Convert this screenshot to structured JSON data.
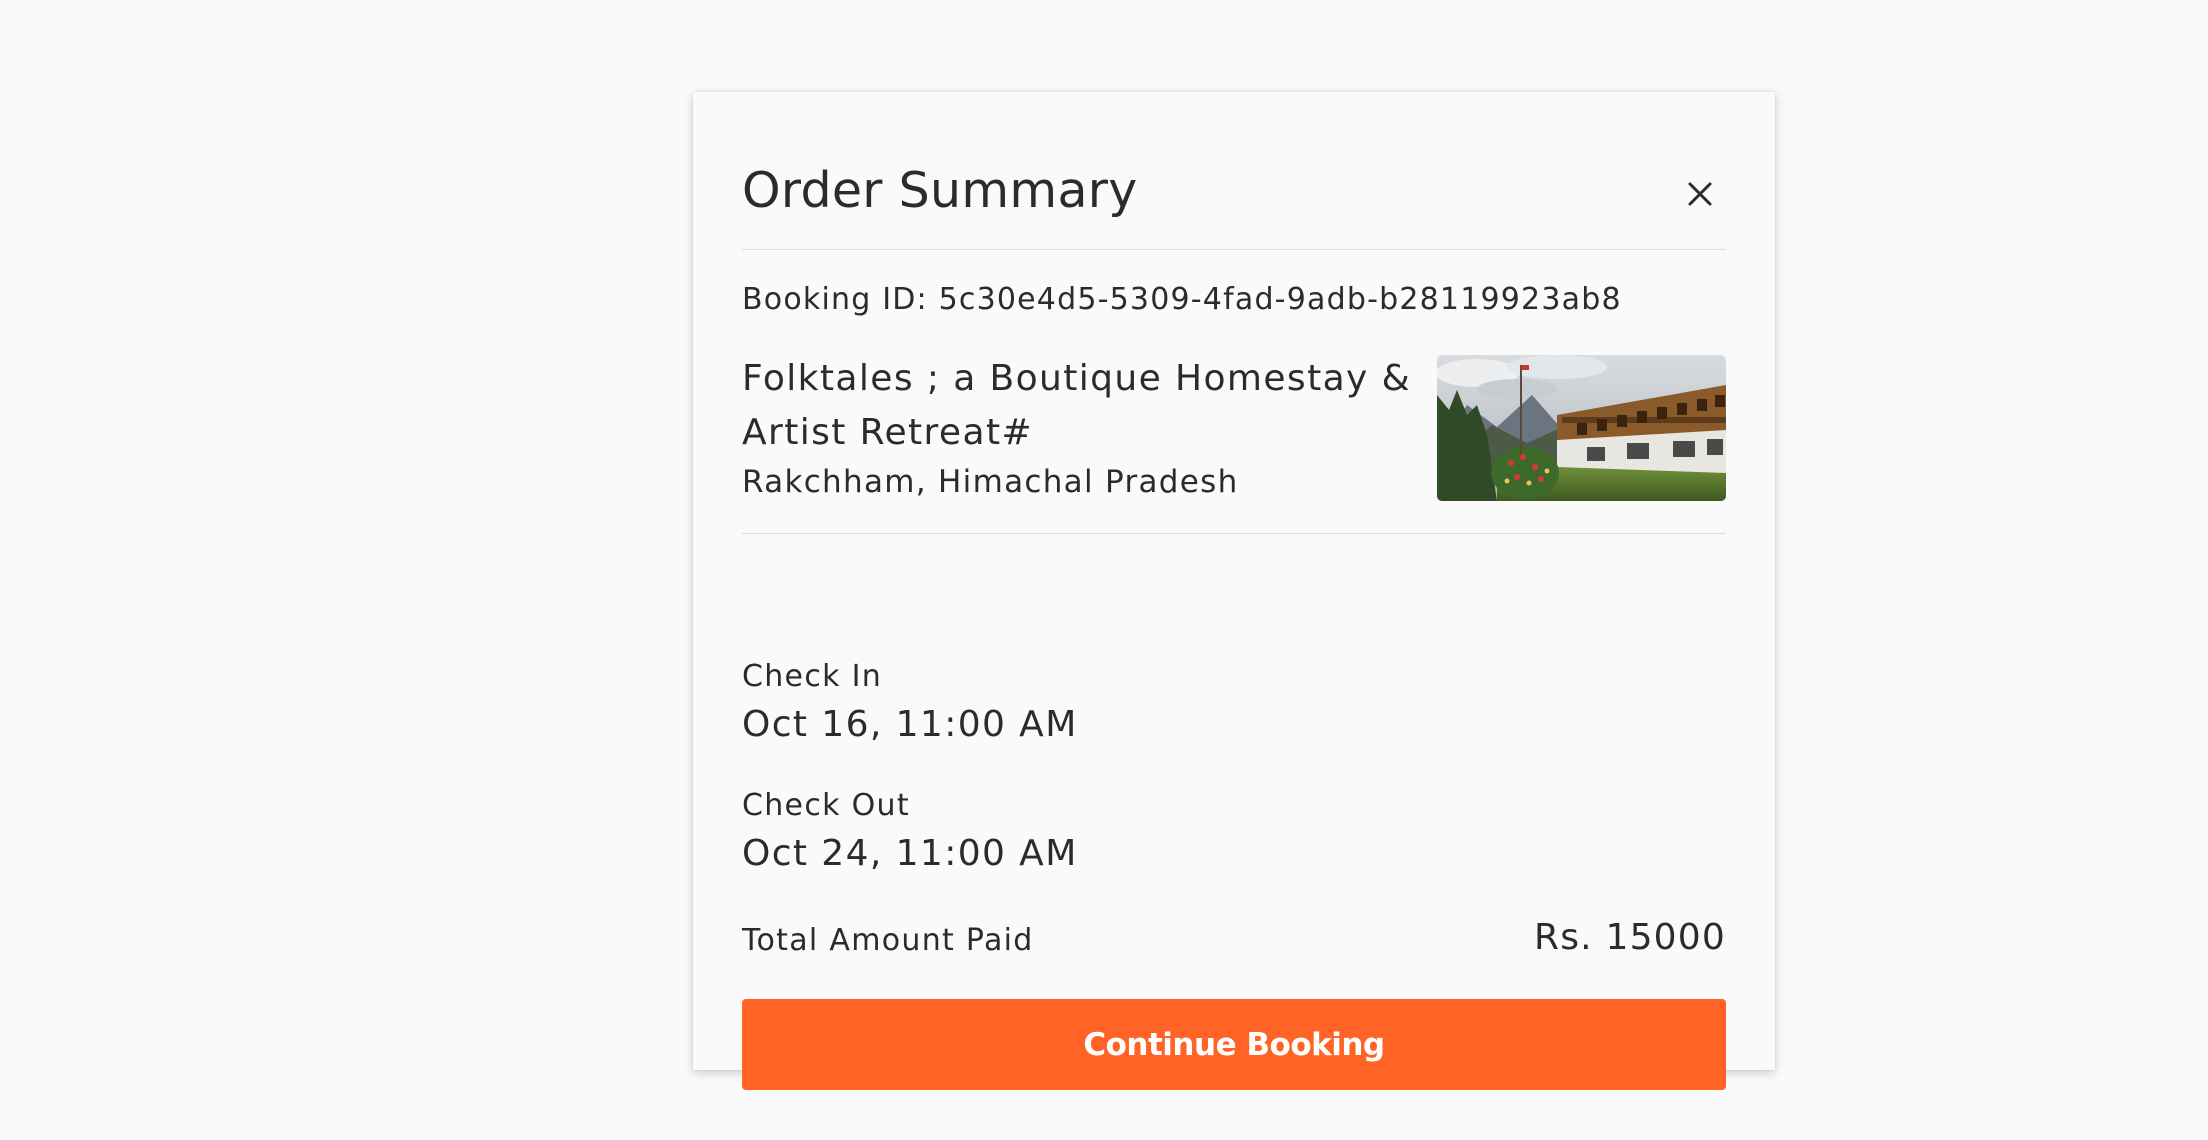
{
  "modal": {
    "title": "Order Summary",
    "close_icon": "close-icon"
  },
  "booking": {
    "id_text": "Booking ID: 5c30e4d5-5309-4fad-9adb-b28119923ab8"
  },
  "property": {
    "name": "Folktales ; a Boutique Homestay & Artist Retreat#",
    "location": "Rakchham, Himachal Pradesh",
    "image_icon": "homestay-photo"
  },
  "check_in": {
    "label": "Check In",
    "value": "Oct 16, 11:00 AM"
  },
  "check_out": {
    "label": "Check Out",
    "value": "Oct 24, 11:00 AM"
  },
  "total": {
    "label": "Total Amount Paid",
    "value": "Rs. 15000"
  },
  "actions": {
    "continue_label": "Continue Booking"
  },
  "colors": {
    "accent": "#ff6325",
    "background": "#fafafa",
    "text": "#2b2b2b",
    "divider": "#dcdcdc"
  }
}
